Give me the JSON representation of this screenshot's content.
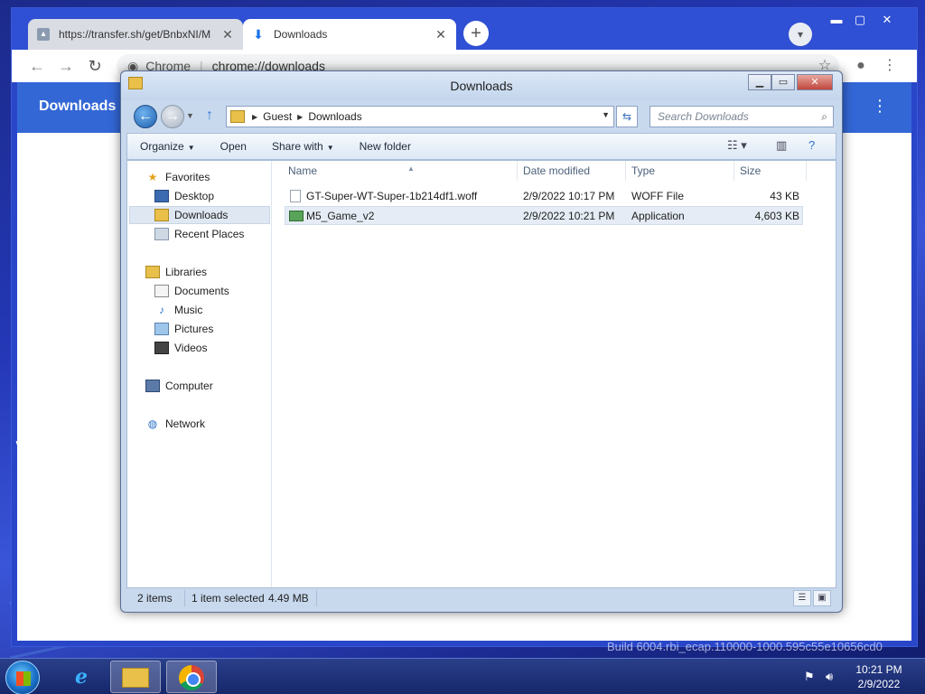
{
  "chrome": {
    "tabs": [
      {
        "label": "https://transfer.sh/get/BnbxNI/M",
        "active": false
      },
      {
        "label": "Downloads",
        "active": true
      }
    ],
    "omnibox": {
      "site": "Chrome",
      "url": "chrome://downloads"
    },
    "page_title": "Downloads",
    "build_text": "Build 6004.rbi_ecap.110000-1000.595c55e10656cd0"
  },
  "explorer": {
    "title": "Downloads",
    "breadcrumb": [
      "Guest",
      "Downloads"
    ],
    "search_placeholder": "Search Downloads",
    "commands": {
      "organize": "Organize",
      "open": "Open",
      "share_with": "Share with",
      "new_folder": "New folder"
    },
    "nav": {
      "favorites": "Favorites",
      "desktop": "Desktop",
      "downloads": "Downloads",
      "recent_places": "Recent Places",
      "libraries": "Libraries",
      "documents": "Documents",
      "music": "Music",
      "pictures": "Pictures",
      "videos": "Videos",
      "computer": "Computer",
      "network": "Network"
    },
    "columns": {
      "name": "Name",
      "date": "Date modified",
      "type": "Type",
      "size": "Size"
    },
    "files": [
      {
        "name": "GT-Super-WT-Super-1b214df1.woff",
        "date": "2/9/2022 10:17 PM",
        "type": "WOFF File",
        "size": "43 KB"
      },
      {
        "name": "M5_Game_v2",
        "date": "2/9/2022 10:21 PM",
        "type": "Application",
        "size": "4,603 KB"
      }
    ],
    "status": {
      "count": "2 items",
      "selected": "1 item selected",
      "size": "4.49 MB"
    }
  },
  "taskbar": {
    "time": "10:21 PM",
    "date": "2/9/2022"
  }
}
